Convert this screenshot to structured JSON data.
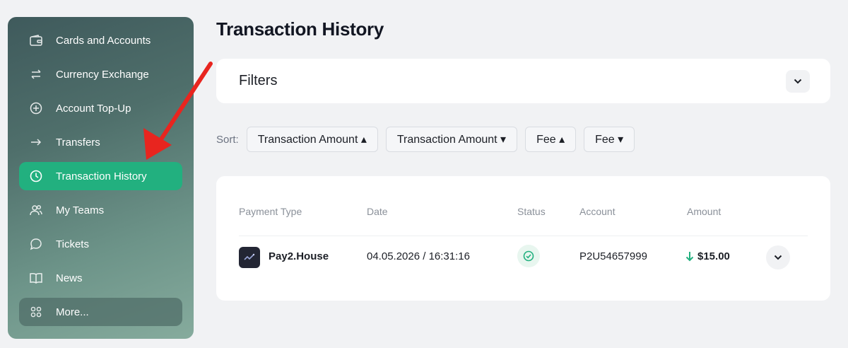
{
  "sidebar": {
    "items": [
      {
        "label": "Cards and Accounts",
        "icon": "wallet-icon"
      },
      {
        "label": "Currency Exchange",
        "icon": "exchange-icon"
      },
      {
        "label": "Account Top-Up",
        "icon": "plus-circle-icon"
      },
      {
        "label": "Transfers",
        "icon": "arrow-right-icon"
      },
      {
        "label": "Transaction History",
        "icon": "clock-icon",
        "active": true
      },
      {
        "label": "My Teams",
        "icon": "users-icon"
      },
      {
        "label": "Tickets",
        "icon": "chat-icon"
      },
      {
        "label": "News",
        "icon": "book-icon"
      },
      {
        "label": "More...",
        "icon": "grid-icon"
      }
    ]
  },
  "page": {
    "title": "Transaction History"
  },
  "filters": {
    "title": "Filters"
  },
  "sort": {
    "label": "Sort:",
    "options": [
      "Transaction Amount ▴",
      "Transaction Amount ▾",
      "Fee ▴",
      "Fee ▾"
    ]
  },
  "table": {
    "headers": [
      "Payment Type",
      "Date",
      "Status",
      "Account",
      "Amount"
    ],
    "rows": [
      {
        "payment_type": "Pay2.House",
        "date": "04.05.2026 / 16:31:16",
        "status": "success",
        "account": "P2U54657999",
        "amount": "$15.00",
        "direction": "incoming"
      }
    ]
  },
  "colors": {
    "accent": "#22b07f",
    "arrow_annotation": "#e8251f"
  }
}
